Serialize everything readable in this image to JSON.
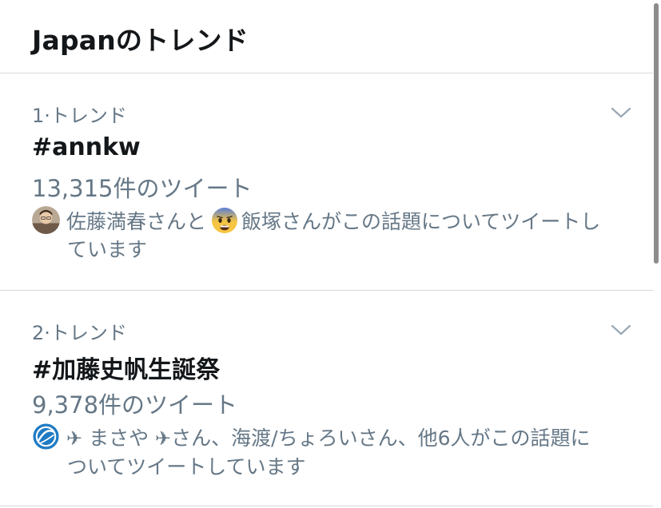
{
  "header": {
    "title": "Japanのトレンド"
  },
  "trends": [
    {
      "meta": "1·トレンド",
      "name": "#annkw",
      "count": "13,315件のツイート",
      "context_line1_user1": "佐藤満春さんと",
      "context_line1_user2": "飯塚さんがこの話題についてツイートし",
      "context_line2": "ています"
    },
    {
      "meta": "2·トレンド",
      "name": "#加藤史帆生誕祭",
      "count": "9,378件のツイート",
      "context_line1_user1": "まさや",
      "context_line1_rest": "さん、海渡/ちょろいさん、他6人がこの話題に",
      "context_line2": "ついてツイートしています"
    }
  ],
  "icons": {
    "chevron": "chevron-down-icon",
    "plane": "airplane-icon",
    "avatar1": "avatar",
    "emoji": "fearful-face-emoji",
    "avatar2": "airline-logo-avatar"
  },
  "colors": {
    "text_primary": "#14171a",
    "text_secondary": "#657786",
    "divider": "#d6d9dc",
    "chevron": "#9aa8b5"
  }
}
